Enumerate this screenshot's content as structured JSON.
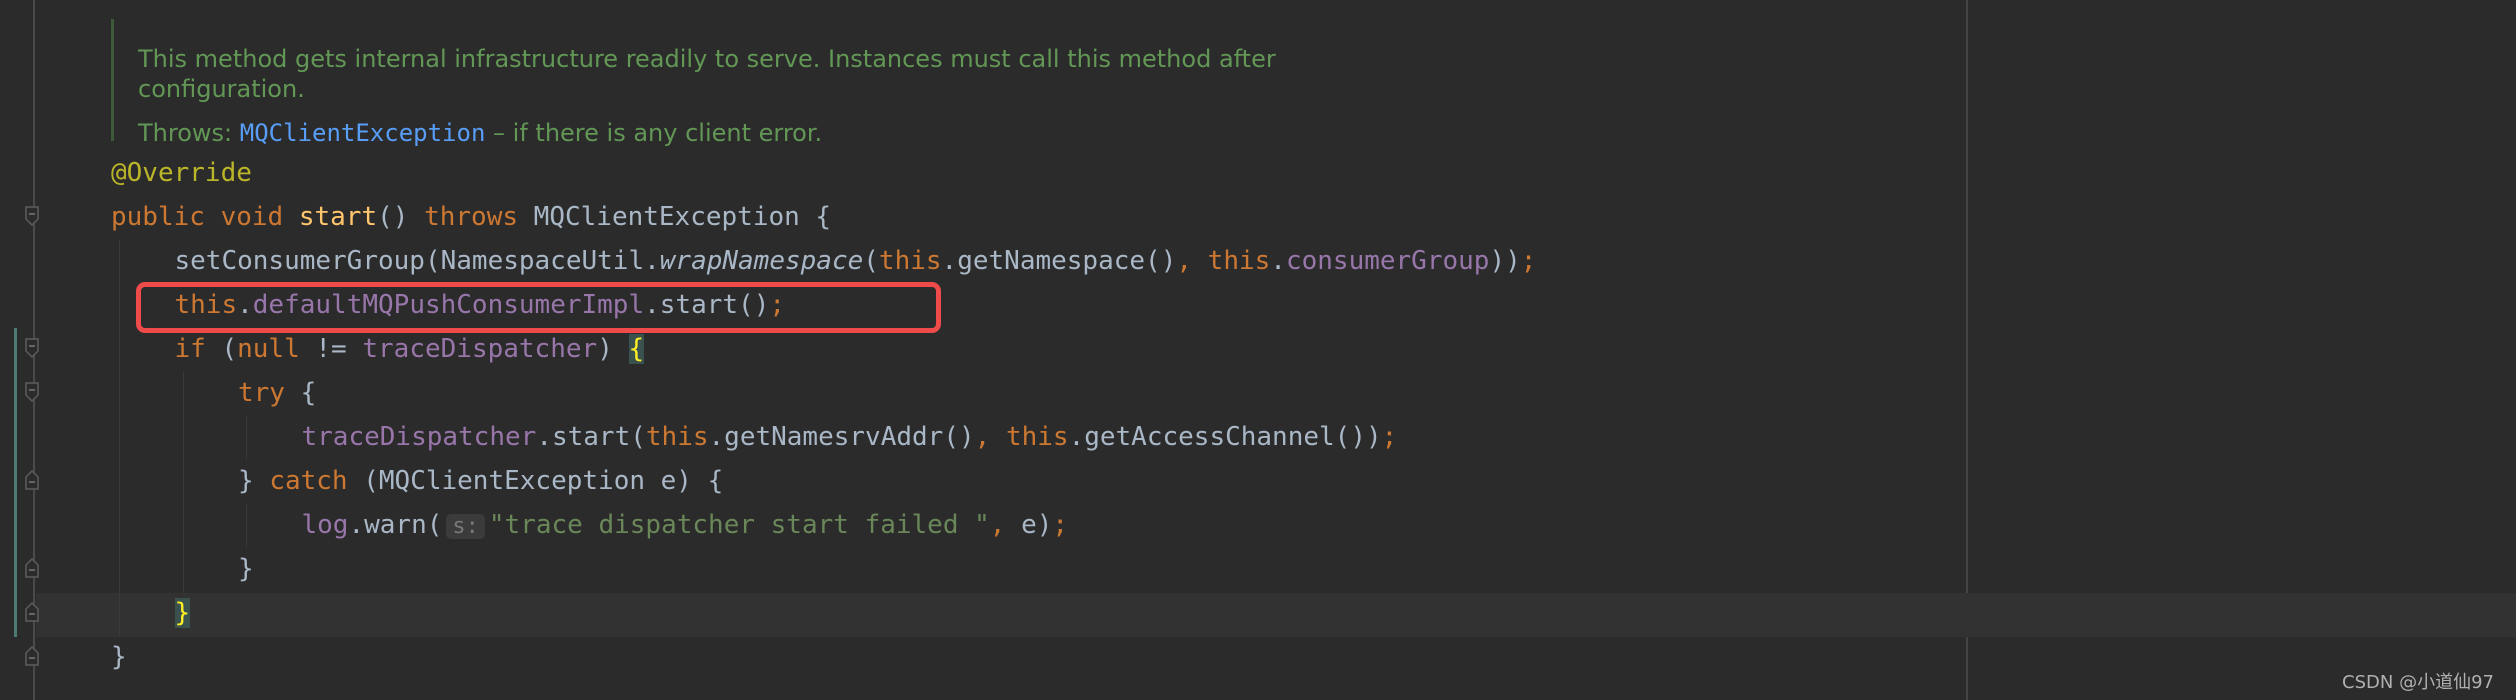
{
  "doc_comment": {
    "line1": "This method gets internal infrastructure readily to serve. Instances must call this method after",
    "line2": "configuration.",
    "throws_label": "Throws:",
    "throws_type": "MQClientException",
    "throws_desc": " – if there is any client error."
  },
  "code_lines": [
    {
      "indent": 0,
      "tokens": [
        {
          "t": "@Override",
          "c": "ann"
        }
      ]
    },
    {
      "indent": 0,
      "tokens": [
        {
          "t": "public void ",
          "c": "kw"
        },
        {
          "t": "start",
          "c": "decl"
        },
        {
          "t": "() "
        },
        {
          "t": "throws ",
          "c": "kw"
        },
        {
          "t": "MQClientException {"
        }
      ]
    },
    {
      "indent": 1,
      "tokens": [
        {
          "t": "setConsumerGroup(NamespaceUtil."
        },
        {
          "t": "wrapNamespace",
          "c": "ital"
        },
        {
          "t": "("
        },
        {
          "t": "this",
          "c": "kw"
        },
        {
          "t": ".getNamespace()"
        },
        {
          "t": ", ",
          "c": "kw"
        },
        {
          "t": "this",
          "c": "kw"
        },
        {
          "t": "."
        },
        {
          "t": "consumerGroup",
          "c": "fld"
        },
        {
          "t": "))"
        },
        {
          "t": ";",
          "c": "kw"
        }
      ]
    },
    {
      "indent": 1,
      "tokens": [
        {
          "t": "this",
          "c": "kw"
        },
        {
          "t": "."
        },
        {
          "t": "defaultMQPushConsumerImpl",
          "c": "fld"
        },
        {
          "t": ".start()"
        },
        {
          "t": ";",
          "c": "kw"
        }
      ]
    },
    {
      "indent": 1,
      "tokens": [
        {
          "t": "if ",
          "c": "kw"
        },
        {
          "t": "("
        },
        {
          "t": "null ",
          "c": "kw"
        },
        {
          "t": "!= "
        },
        {
          "t": "traceDispatcher",
          "c": "fld"
        },
        {
          "t": ") "
        },
        {
          "t": "{",
          "c": "brace"
        }
      ]
    },
    {
      "indent": 2,
      "tokens": [
        {
          "t": "try ",
          "c": "kw"
        },
        {
          "t": "{"
        }
      ]
    },
    {
      "indent": 3,
      "tokens": [
        {
          "t": "traceDispatcher",
          "c": "fld"
        },
        {
          "t": ".start("
        },
        {
          "t": "this",
          "c": "kw"
        },
        {
          "t": ".getNamesrvAddr()"
        },
        {
          "t": ", ",
          "c": "kw"
        },
        {
          "t": "this",
          "c": "kw"
        },
        {
          "t": ".getAccessChannel())"
        },
        {
          "t": ";",
          "c": "kw"
        }
      ]
    },
    {
      "indent": 2,
      "tokens": [
        {
          "t": "} "
        },
        {
          "t": "catch ",
          "c": "kw"
        },
        {
          "t": "(MQClientException e) {"
        }
      ]
    },
    {
      "indent": 3,
      "tokens": [
        {
          "t": "log",
          "c": "fld"
        },
        {
          "t": ".warn("
        },
        {
          "t": "s:",
          "c": "hint"
        },
        {
          "t": "\"trace dispatcher start failed \"",
          "c": "str"
        },
        {
          "t": ", ",
          "c": "kw"
        },
        {
          "t": "e)"
        },
        {
          "t": ";",
          "c": "kw"
        }
      ]
    },
    {
      "indent": 2,
      "tokens": [
        {
          "t": "}"
        }
      ]
    },
    {
      "indent": 1,
      "tokens": [
        {
          "t": "}",
          "c": "brace"
        }
      ]
    },
    {
      "indent": 0,
      "tokens": [
        {
          "t": "}"
        }
      ]
    }
  ],
  "highlighted_line": 3,
  "current_line": 10,
  "colors": {
    "background": "#2b2b2b",
    "keyword": "#cc7832",
    "field": "#9876aa",
    "string": "#6a8759",
    "highlight_box": "#f04b4b"
  },
  "watermark": "CSDN @小道仙97"
}
